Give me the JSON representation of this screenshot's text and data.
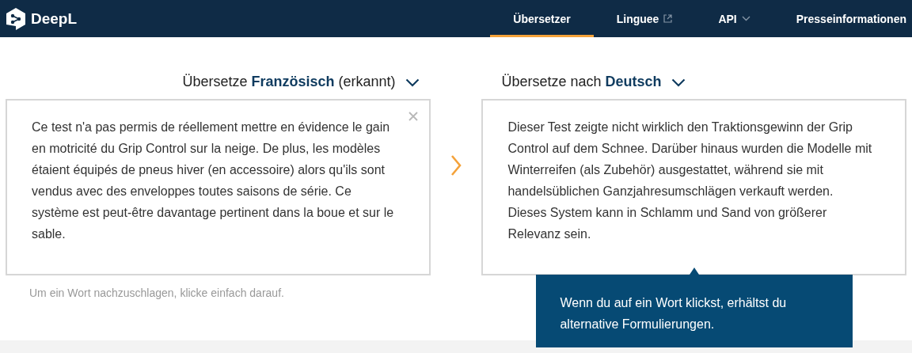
{
  "header": {
    "logo": "DeepL",
    "nav": [
      {
        "label": "Übersetzer",
        "selected": true,
        "kind": "plain"
      },
      {
        "label": "Linguee",
        "selected": false,
        "kind": "external"
      },
      {
        "label": "API",
        "selected": false,
        "kind": "dropdown"
      },
      {
        "label": "Presseinformationen",
        "selected": false,
        "kind": "plain"
      }
    ]
  },
  "source": {
    "language": "Übersetze **Französisch** (erkannt)",
    "text": "Ce test n'a pas permis de réellement mettre en évidence le gain en motricité du Grip Control sur la neige. De plus, les modèles étaient équipés de pneus hiver (en accessoire) alors qu'ils sont vendus avec des enveloppes toutes saisons de série. Ce système est peut-être davantage pertinent dans la boue et sur le sable.",
    "hint": "Um ein Wort nachzuschlagen, klicke einfach darauf."
  },
  "target": {
    "language": "Übersetze nach **Deutsch**",
    "text": "Dieser Test zeigte nicht wirklich den Traktionsgewinn der Grip Control auf dem Schnee. Darüber hinaus wurden die Modelle mit Winterreifen (als Zubehör) ausgestattet, während sie mit handelsüblichen Ganzjahresumschlägen verkauft werden. Dieses System kann in Schlamm und Sand von größerer Relevanz sein."
  },
  "tooltip": {
    "text": "Wenn du auf ein Wort klickst, erhältst du alternative Formulierungen."
  }
}
